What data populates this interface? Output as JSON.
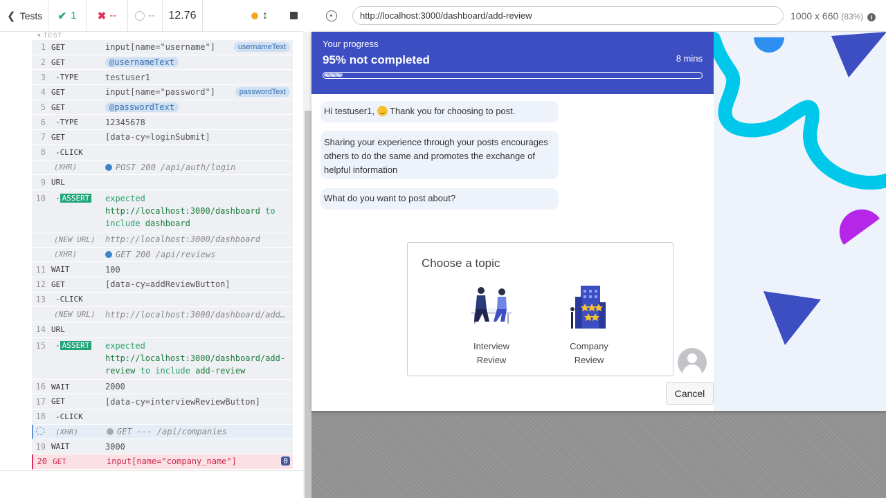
{
  "runner": {
    "back_label": "Tests",
    "passed": "1",
    "failed": "--",
    "pending": "--",
    "duration": "12.76",
    "test_label": "TEST",
    "commands": [
      {
        "num": "1",
        "name": "GET",
        "msg": "input[name=\"username\"]",
        "tag": "usernameText"
      },
      {
        "num": "2",
        "name": "GET",
        "alias": "@usernameText"
      },
      {
        "num": "3",
        "name": "-TYPE",
        "msg": "testuser1"
      },
      {
        "num": "4",
        "name": "GET",
        "msg": "input[name=\"password\"]",
        "tag": "passwordText"
      },
      {
        "num": "5",
        "name": "GET",
        "alias": "@passwordText"
      },
      {
        "num": "6",
        "name": "-TYPE",
        "msg": "12345678"
      },
      {
        "num": "7",
        "name": "GET",
        "msg": "[data-cy=loginSubmit]"
      },
      {
        "num": "8",
        "name": "-CLICK",
        "msg": ""
      },
      {
        "num": "",
        "name": "(XHR)",
        "msg": "POST 200 /api/auth/login"
      },
      {
        "num": "9",
        "name": "URL",
        "msg": ""
      },
      {
        "num": "10",
        "name": "ASSERT",
        "expected": "expected",
        "url": "http://localhost:3000/dashboard",
        "to": "to",
        "include": "include",
        "value": "dashboard"
      },
      {
        "num": "",
        "name": "(NEW URL)",
        "msg": "http://localhost:3000/dashboard"
      },
      {
        "num": "",
        "name": "(XHR)",
        "msg": "GET 200 /api/reviews"
      },
      {
        "num": "11",
        "name": "WAIT",
        "msg": "100"
      },
      {
        "num": "12",
        "name": "GET",
        "msg": "[data-cy=addReviewButton]"
      },
      {
        "num": "13",
        "name": "-CLICK",
        "msg": ""
      },
      {
        "num": "",
        "name": "(NEW URL)",
        "msg": "http://localhost:3000/dashboard/add…"
      },
      {
        "num": "14",
        "name": "URL",
        "msg": ""
      },
      {
        "num": "15",
        "name": "ASSERT",
        "expected": "expected",
        "url1": "http://localhost:3000/dashboard/add-",
        "url2": "review",
        "to": "to",
        "include": "include",
        "value": "add-review"
      },
      {
        "num": "16",
        "name": "WAIT",
        "msg": "2000"
      },
      {
        "num": "17",
        "name": "GET",
        "msg": "[data-cy=interviewReviewButton]"
      },
      {
        "num": "18",
        "name": "-CLICK",
        "msg": ""
      },
      {
        "num": "",
        "name": "(XHR)",
        "msg": "GET --- /api/companies"
      },
      {
        "num": "19",
        "name": "WAIT",
        "msg": "3000"
      },
      {
        "num": "20",
        "name": "GET",
        "msg": "input[name=\"company_name\"]",
        "count": "0"
      }
    ]
  },
  "aut": {
    "url": "http://localhost:3000/dashboard/add-review",
    "viewport": "1000 x 660",
    "scale": "(83%)",
    "progress": {
      "label": "Your progress",
      "status": "95% not completed",
      "time": "8 mins",
      "completed_fraction": 0.05
    },
    "messages": {
      "greeting_a": "Hi testuser1,",
      "greeting_b": "Thank you for choosing to post.",
      "sharing": "Sharing your experience through your posts encourages others to do the same and promotes the exchange of helpful information",
      "question": "What do you want to post about?"
    },
    "topic_card": {
      "title": "Choose a topic",
      "options": [
        {
          "line1": "Interview",
          "line2": "Review"
        },
        {
          "line1": "Company",
          "line2": "Review"
        }
      ]
    },
    "cancel_label": "Cancel"
  },
  "colors": {
    "brand_blue": "#3d4ec2",
    "pass_green": "#1fa971",
    "fail_red": "#e0335b",
    "cyan": "#00c8ea",
    "purple": "#b626e8"
  }
}
